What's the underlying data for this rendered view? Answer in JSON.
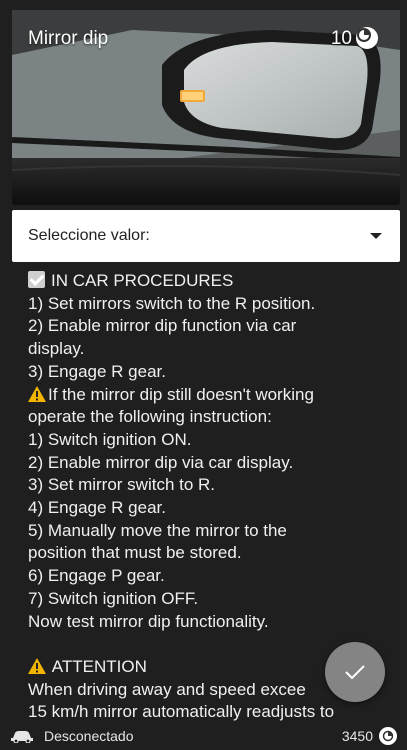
{
  "header": {
    "title": "Mirror dip",
    "count": "10",
    "coin_icon": "coin-icon",
    "image_icon": "car-mirror-image"
  },
  "select": {
    "label": "Seleccione valor:",
    "caret_icon": "chevron-down-icon"
  },
  "content": {
    "section1_title": "IN CAR PROCEDURES",
    "lines": [
      "1) Set mirrors switch to the R position.",
      "2) Enable mirror dip function via car",
      "display.",
      "3) Engage R gear."
    ],
    "warn_line1": "If the mirror dip still doesn't working",
    "lines2": [
      "operate the following instruction:",
      "1) Switch ignition ON.",
      "2) Enable mirror dip via car display.",
      "3) Set mirror switch to R.",
      "4) Engage R gear.",
      "5) Manually move the mirror to the",
      "position that must be stored.",
      "6) Engage P gear.",
      "7) Switch ignition OFF.",
      "Now test mirror dip functionality."
    ],
    "attention_title": "ATTENTION",
    "lines3": [
      "When driving away and speed excee",
      "15 km/h mirror automatically readjusts to"
    ]
  },
  "fab": {
    "icon": "checkmark-icon"
  },
  "footer": {
    "status": "Desconectado",
    "coins": "3450",
    "car_icon": "car-link-icon"
  },
  "colors": {
    "background": "#1f1f1f",
    "select_bg": "#ffffff",
    "warning": "#f2b400"
  }
}
